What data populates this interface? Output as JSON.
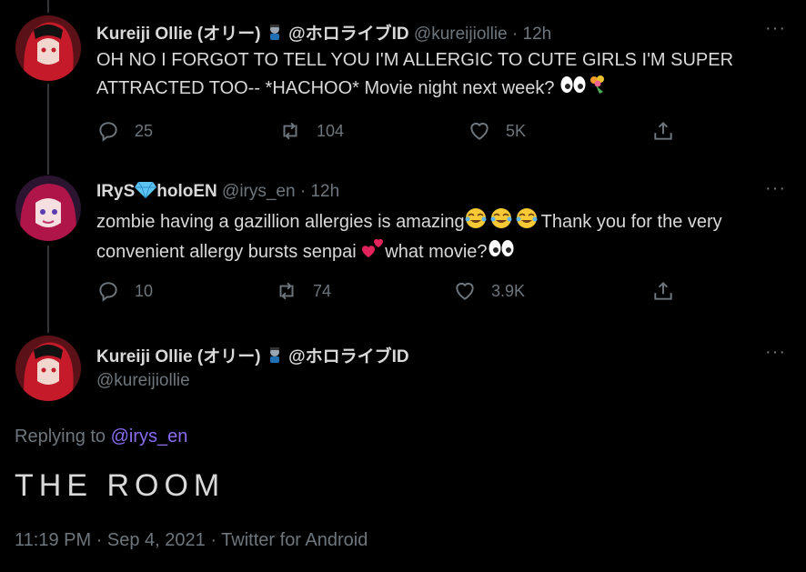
{
  "tweets": [
    {
      "name": "Kureiji Ollie (オリー)",
      "name_suffix": "@ホロライブID",
      "handle": "@kureijiollie",
      "sep": "·",
      "time": "12h",
      "text_line1": "OH NO I FORGOT TO TELL YOU I'M ALLERGIC TO CUTE GIRLS I'M SUPER",
      "text_line2": "ATTRACTED TOO-- *HACHOO* Movie night next week?",
      "replies": "25",
      "retweets": "104",
      "likes": "5K"
    },
    {
      "name": "IRyS",
      "name_suffix": "holoEN",
      "handle": "@irys_en",
      "sep": "·",
      "time": "12h",
      "text_line1a": "zombie having a gazillion allergies is amazing",
      "text_line1b": "Thank you for the very",
      "text_line2a": "convenient allergy bursts senpai ",
      "text_line2b": "what movie?",
      "replies": "10",
      "retweets": "74",
      "likes": "3.9K"
    }
  ],
  "main_tweet": {
    "name": "Kureiji Ollie (オリー)",
    "name_suffix": "@ホロライブID",
    "handle": "@kureijiollie",
    "replying_prefix": "Replying to ",
    "replying_to": "@irys_en",
    "text": "THE ROOM",
    "meta": "11:19 PM · Sep 4, 2021 · Twitter for Android"
  },
  "more_icon": "···",
  "colors": {
    "background": "#000000",
    "text": "#d9d9d9",
    "muted": "#6e767d",
    "mention": "#8b6cf0"
  }
}
